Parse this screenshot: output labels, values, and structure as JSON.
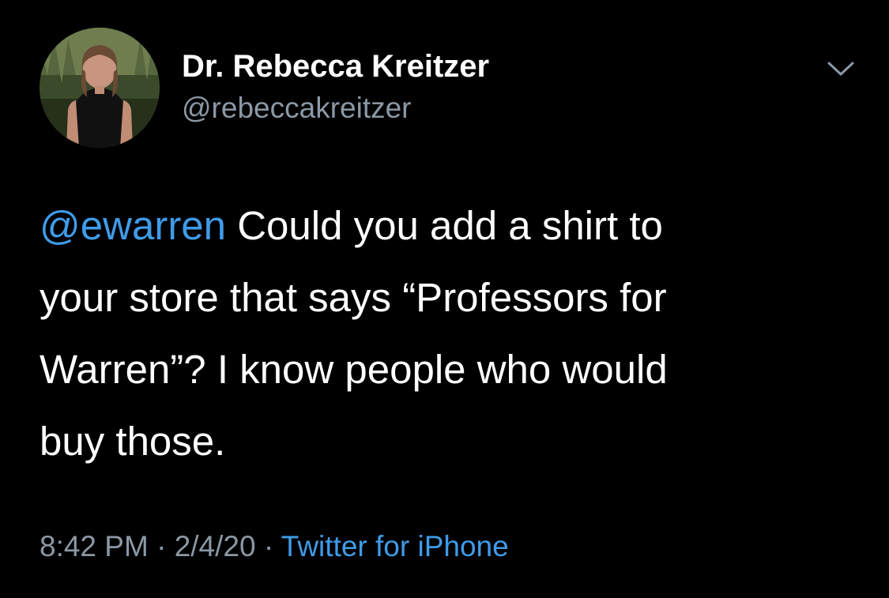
{
  "author": {
    "display_name": "Dr. Rebecca Kreitzer",
    "handle": "@rebeccakreitzer"
  },
  "menu_icon": "chevron-down-icon",
  "tweet": {
    "mention": "@ewarren",
    "line1_rest": " Could you add a shirt to",
    "line2": "your store that says “Professors for",
    "line3": "Warren”? I know people who would",
    "line4": "buy those."
  },
  "meta": {
    "time": "8:42 PM",
    "separator": " · ",
    "date": "2/4/20",
    "source": "Twitter for iPhone"
  },
  "colors": {
    "background": "#000000",
    "text": "#ffffff",
    "secondary": "#8b98a5",
    "link": "#3f9be8"
  }
}
